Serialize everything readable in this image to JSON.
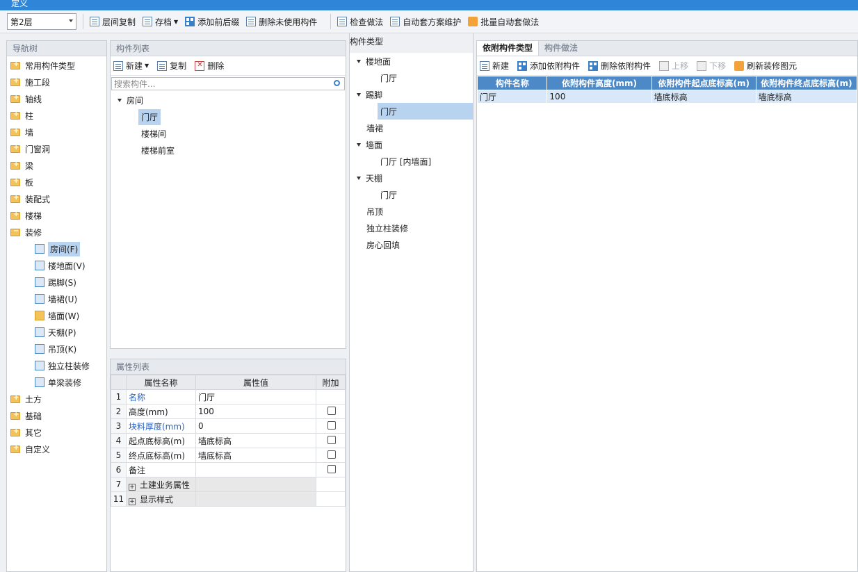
{
  "window": {
    "title": "定义"
  },
  "toolbar": {
    "floor": "第2层",
    "buttons": [
      "层间复制",
      "存档",
      "添加前后缀",
      "删除未使用构件",
      "检查做法",
      "自动套方案维护",
      "批量自动套做法"
    ]
  },
  "nav": {
    "title": "导航树",
    "items": [
      "常用构件类型",
      "施工段",
      "轴线",
      "柱",
      "墙",
      "门窗洞",
      "梁",
      "板",
      "装配式",
      "楼梯",
      "装修"
    ],
    "sub_items": [
      "房间(F)",
      "楼地面(V)",
      "踢脚(S)",
      "墙裙(U)",
      "墙面(W)",
      "天棚(P)",
      "吊顶(K)",
      "独立柱装修",
      "单梁装修"
    ],
    "items_after": [
      "土方",
      "基础",
      "其它",
      "自定义"
    ]
  },
  "component_list": {
    "title": "构件列表",
    "buttons": [
      "新建",
      "复制",
      "删除"
    ],
    "search_placeholder": "搜索构件...",
    "root": "房间",
    "children": [
      "门厅",
      "楼梯间",
      "楼梯前室"
    ]
  },
  "properties": {
    "title": "属性列表",
    "headers": [
      "属性名称",
      "属性值",
      "附加"
    ],
    "rows": [
      {
        "num": "1",
        "name": "名称",
        "value": "门厅"
      },
      {
        "num": "2",
        "name": "高度(mm)",
        "value": "100"
      },
      {
        "num": "3",
        "name": "块料厚度(mm)",
        "value": "0"
      },
      {
        "num": "4",
        "name": "起点底标高(m)",
        "value": "墙底标高"
      },
      {
        "num": "5",
        "name": "终点底标高(m)",
        "value": "墙底标高"
      },
      {
        "num": "6",
        "name": "备注",
        "value": ""
      },
      {
        "num": "7",
        "name": "土建业务属性",
        "value": ""
      },
      {
        "num": "11",
        "name": "显示样式",
        "value": ""
      }
    ]
  },
  "types": {
    "title": "构件类型",
    "tree": {
      "floor": "楼地面",
      "floor_child": "门厅",
      "skirting": "踢脚",
      "skirting_child": "门厅",
      "dado": "墙裙",
      "wall": "墙面",
      "wall_child": "门厅 [内墙面]",
      "ceiling": "天棚",
      "ceiling_child": "门厅",
      "suspended": "吊顶",
      "column": "独立柱装修",
      "backfill": "房心回填"
    }
  },
  "right": {
    "tabs": [
      "依附构件类型",
      "构件做法"
    ],
    "buttons": [
      "新建",
      "添加依附构件",
      "删除依附构件",
      "上移",
      "下移",
      "刷新装修图元"
    ],
    "headers": [
      "构件名称",
      "依附构件高度(mm)",
      "依附构件起点底标高(m)",
      "依附构件终点底标高(m)"
    ],
    "row": [
      "门厅",
      "100",
      "墙底标高",
      "墙底标高"
    ]
  }
}
